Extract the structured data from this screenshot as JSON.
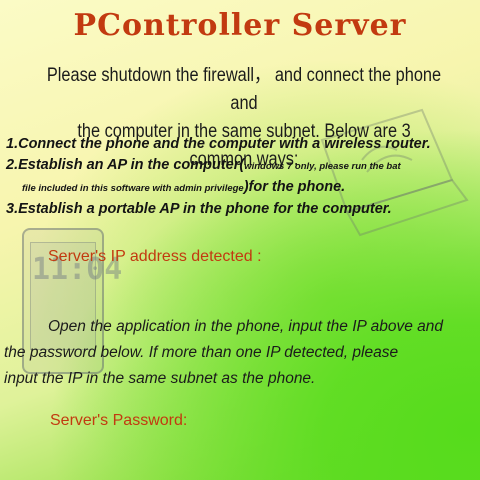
{
  "app": {
    "title": "PController Server"
  },
  "intro": {
    "line1": "Please shutdown the firewall， and connect the phone and",
    "line2": "the computer in the same subnet. Below are 3 common ways:"
  },
  "ways": {
    "way1": "1.Connect the phone and the computer with a wireless router.",
    "way2_part1": "2.Establish an AP in the computer(",
    "way2_small1": "windows 7 only, please run the bat",
    "way2_small2": "file included in this software with admin privilege",
    "way2_part2": ")for the phone.",
    "way3": "3.Establish a portable AP in the phone for the computer."
  },
  "ip": {
    "label": "Server's IP address detected :",
    "value": ""
  },
  "instructions": {
    "line1": "Open the application in the phone, input the  IP above and",
    "line2": "the  password below. If more than one IP detected, please",
    "line3": "input the IP in the same subnet as the phone."
  },
  "password": {
    "label": "Server's Password:",
    "value": ""
  },
  "illustration": {
    "phone_clock": "11:04",
    "icons": [
      "phone-illustration",
      "laptop-illustration"
    ]
  },
  "colors": {
    "accent": "#c23a10",
    "text": "#1b1b1b",
    "background_top": "#fbfbc6",
    "background_bottom": "#56dc1c"
  }
}
